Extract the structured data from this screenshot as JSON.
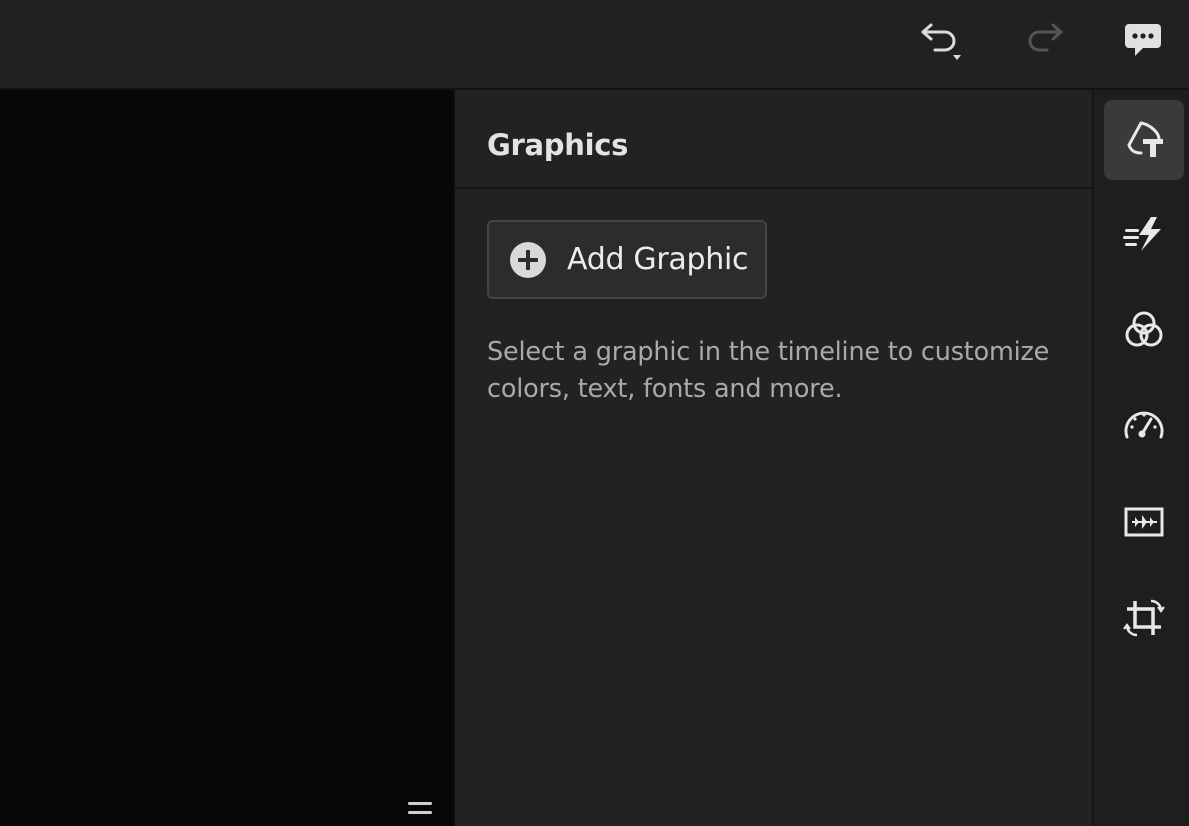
{
  "toolbar": {
    "undo_icon": "undo-icon",
    "redo_icon": "redo-icon",
    "feedback_icon": "feedback-speech-bubble-icon"
  },
  "panel": {
    "title": "Graphics",
    "add_button_label": "Add Graphic",
    "hint": "Select a graphic in the timeline to customize colors, text, fonts and more."
  },
  "rail": {
    "items": [
      {
        "icon": "graphics-icon",
        "active": true
      },
      {
        "icon": "transitions-speed-icon",
        "active": false
      },
      {
        "icon": "color-circles-icon",
        "active": false
      },
      {
        "icon": "speedometer-icon",
        "active": false
      },
      {
        "icon": "audio-waveform-icon",
        "active": false
      },
      {
        "icon": "crop-rotate-icon",
        "active": false
      }
    ]
  },
  "colors": {
    "background": "#1f1f1f",
    "viewer": "#080808",
    "icon": "#e8e8e8",
    "icon_disabled": "#555555"
  }
}
